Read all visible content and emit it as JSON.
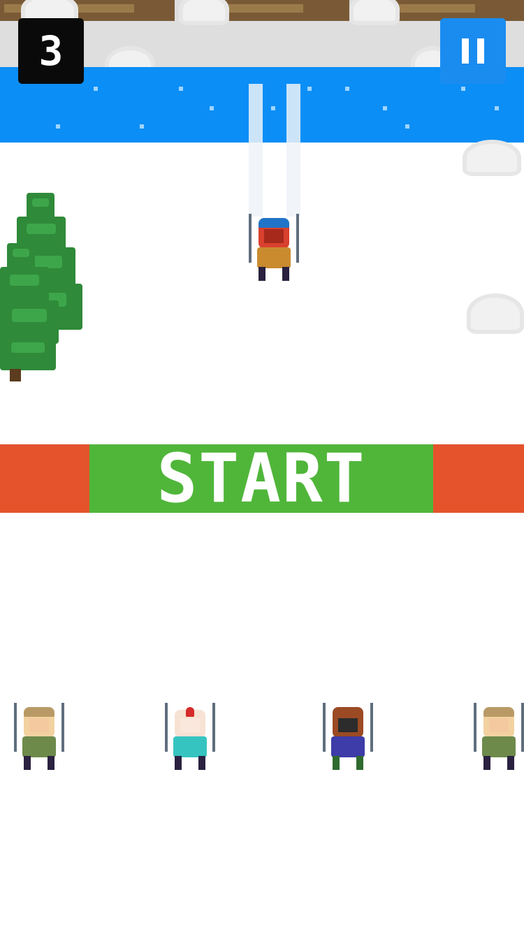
{
  "hud": {
    "score": "3",
    "pause_icon": "pause-icon"
  },
  "banner": {
    "label": "START"
  },
  "colors": {
    "river": "#0b8ef6",
    "banner_green": "#50b63a",
    "banner_red": "#e4532c",
    "score_bg": "#0a0a0a",
    "pause_bg": "#1a8cf0"
  },
  "scene": {
    "player": "player-skier",
    "characters": [
      "ranger-skier",
      "mohawk-skier",
      "bearded-skier",
      "ranger-skier"
    ]
  }
}
